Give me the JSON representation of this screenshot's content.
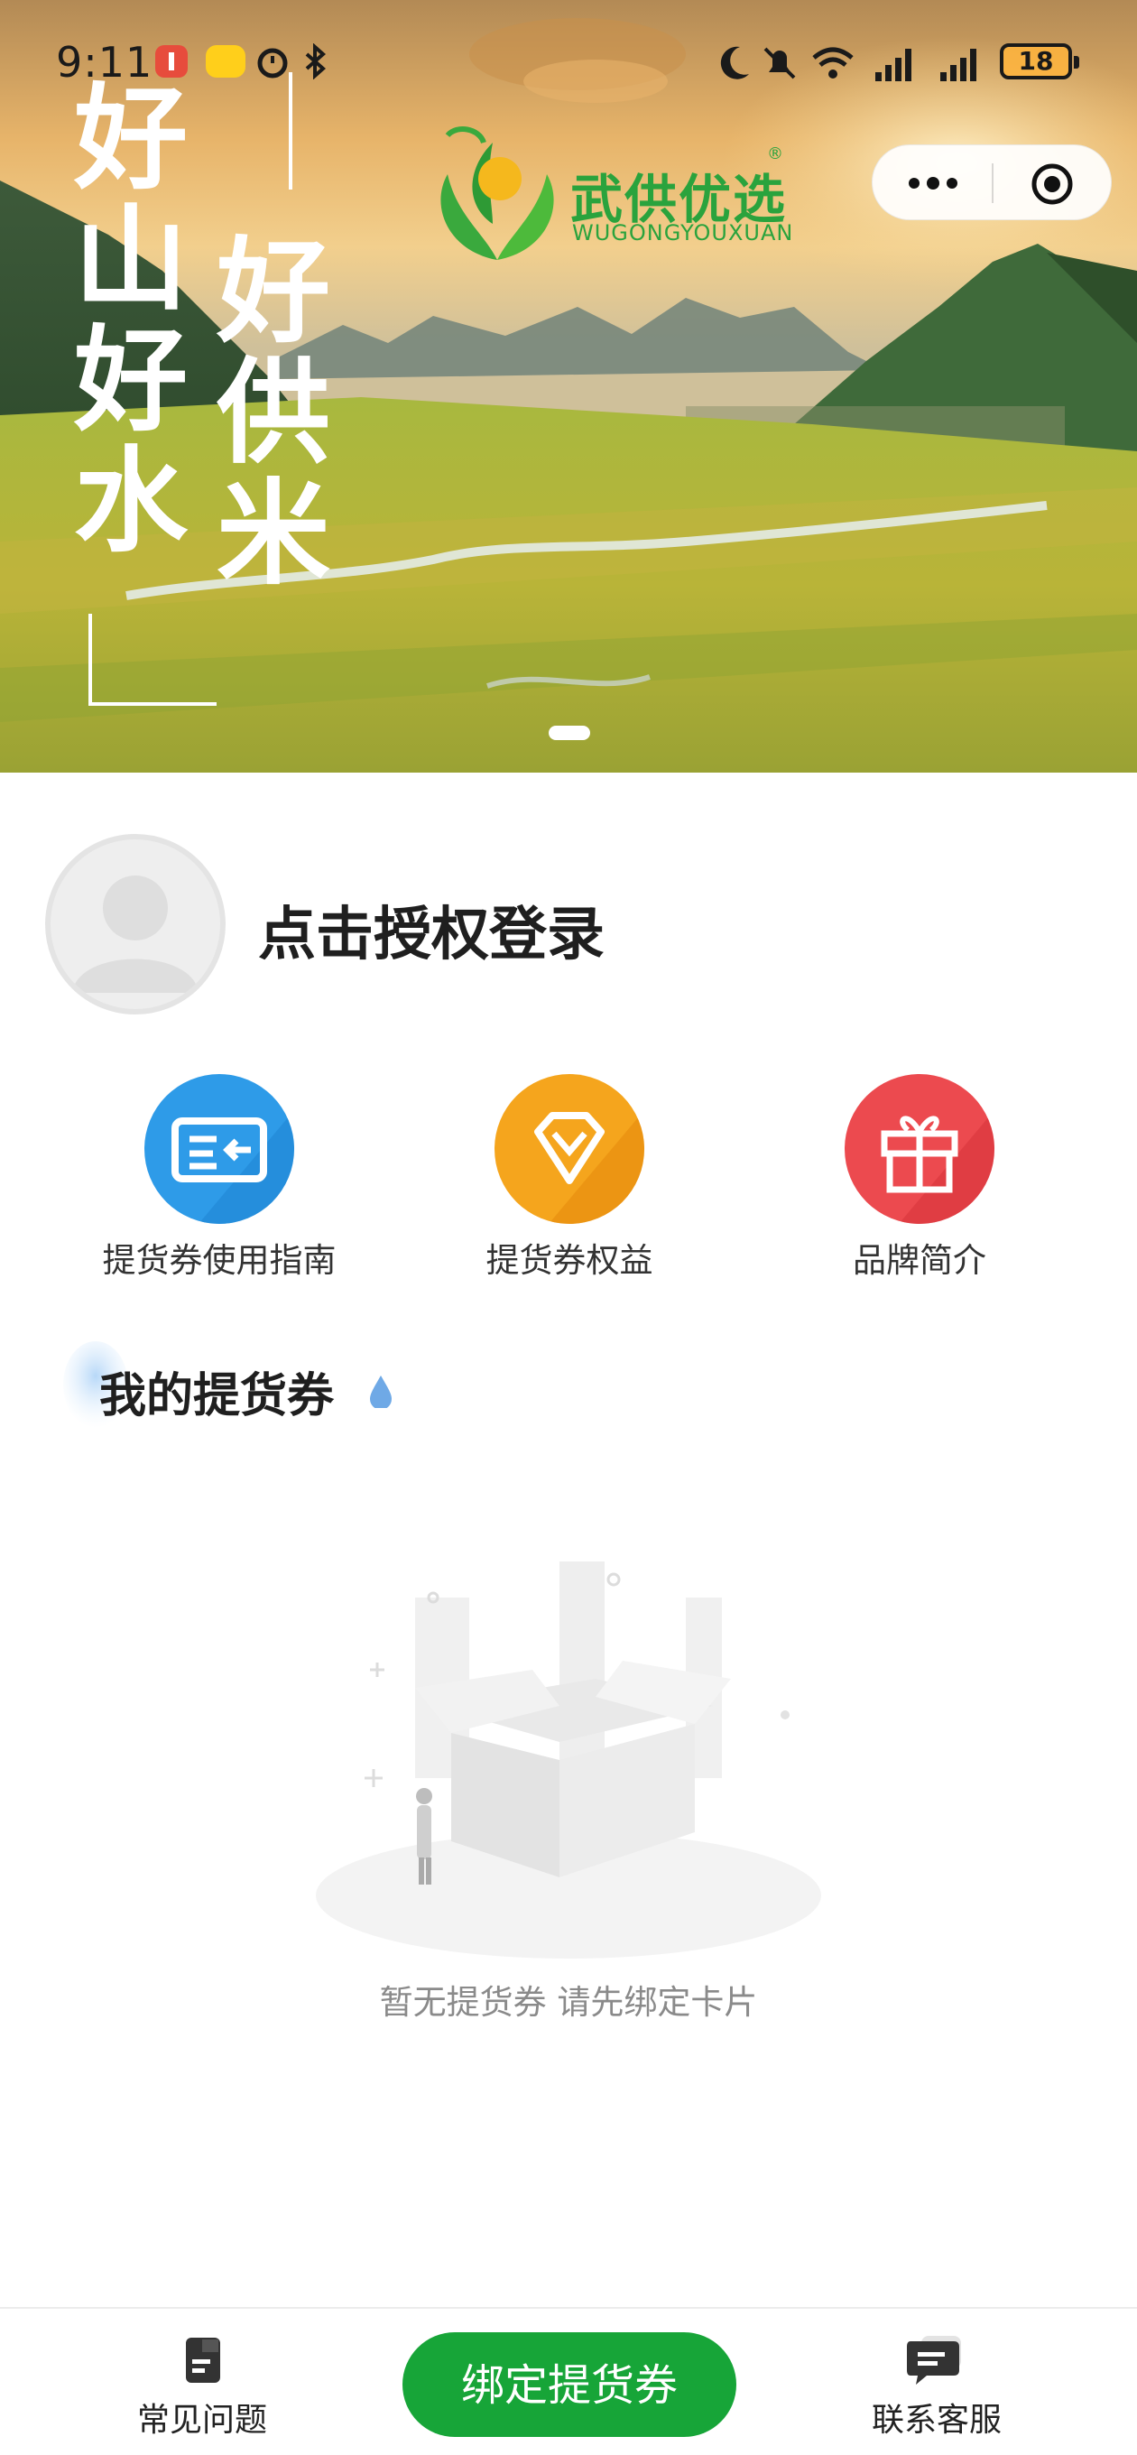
{
  "status_bar": {
    "time": "9:11",
    "battery": "18"
  },
  "banner": {
    "slogan_left": [
      "好",
      "山",
      "好",
      "水"
    ],
    "slogan_right": [
      "好",
      "供",
      "米"
    ],
    "logo_cn": "武供优选",
    "logo_en": "WUGONGYOUXUAN",
    "logo_mark": "®"
  },
  "profile": {
    "login_text": "点击授权登录"
  },
  "actions": [
    {
      "label": "提货券使用指南",
      "icon": "voucher-guide-icon",
      "color": "#2e9be8"
    },
    {
      "label": "提货券权益",
      "icon": "diamond-icon",
      "color": "#f5a51d"
    },
    {
      "label": "品牌简介",
      "icon": "gift-icon",
      "color": "#ec4a4f"
    }
  ],
  "vouchers": {
    "title": "我的提货券",
    "empty_text": "暂无提货券 请先绑定卡片"
  },
  "bottom_bar": {
    "faq_label": "常见问题",
    "bind_label": "绑定提货券",
    "service_label": "联系客服"
  },
  "colors": {
    "primary_green": "#17a538",
    "guide_blue": "#2e9be8",
    "benefit_orange": "#f5a51d",
    "brand_red": "#ec4a4f"
  }
}
